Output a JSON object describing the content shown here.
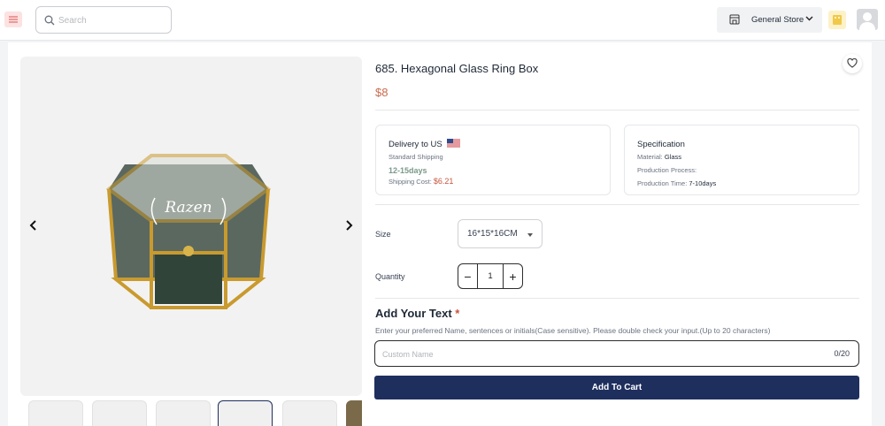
{
  "header": {
    "search_placeholder": "Search",
    "store_label": "General Store"
  },
  "product": {
    "title": "685. Hexagonal Glass Ring Box",
    "price": "$8",
    "engraving": "Razen"
  },
  "delivery": {
    "title": "Delivery to US",
    "method": "Standard Shipping",
    "days": "12-15days",
    "cost_label": "Shipping Cost:",
    "cost_value": "$6.21"
  },
  "specification": {
    "title": "Specification",
    "material_label": "Material:",
    "material_value": "Glass",
    "process_label": "Production Process:",
    "time_label": "Production Time:",
    "time_value": "7-10days"
  },
  "options": {
    "size_label": "Size",
    "size_value": "16*15*16CM",
    "quantity_label": "Quantity",
    "quantity_value": "1",
    "minus": "−",
    "plus": "+"
  },
  "custom_text": {
    "title": "Add Your Text",
    "required_mark": "*",
    "hint": "Enter your preferred Name, sentences or initials(Case sensitive). Please double check your input.(Up to 20 characters)",
    "placeholder": "Custom Name",
    "counter": "0/20"
  },
  "actions": {
    "add_to_cart": "Add To Cart"
  },
  "colors": {
    "primary": "#1e2f5e",
    "price": "#c96c4c",
    "cost": "#c9543c"
  }
}
